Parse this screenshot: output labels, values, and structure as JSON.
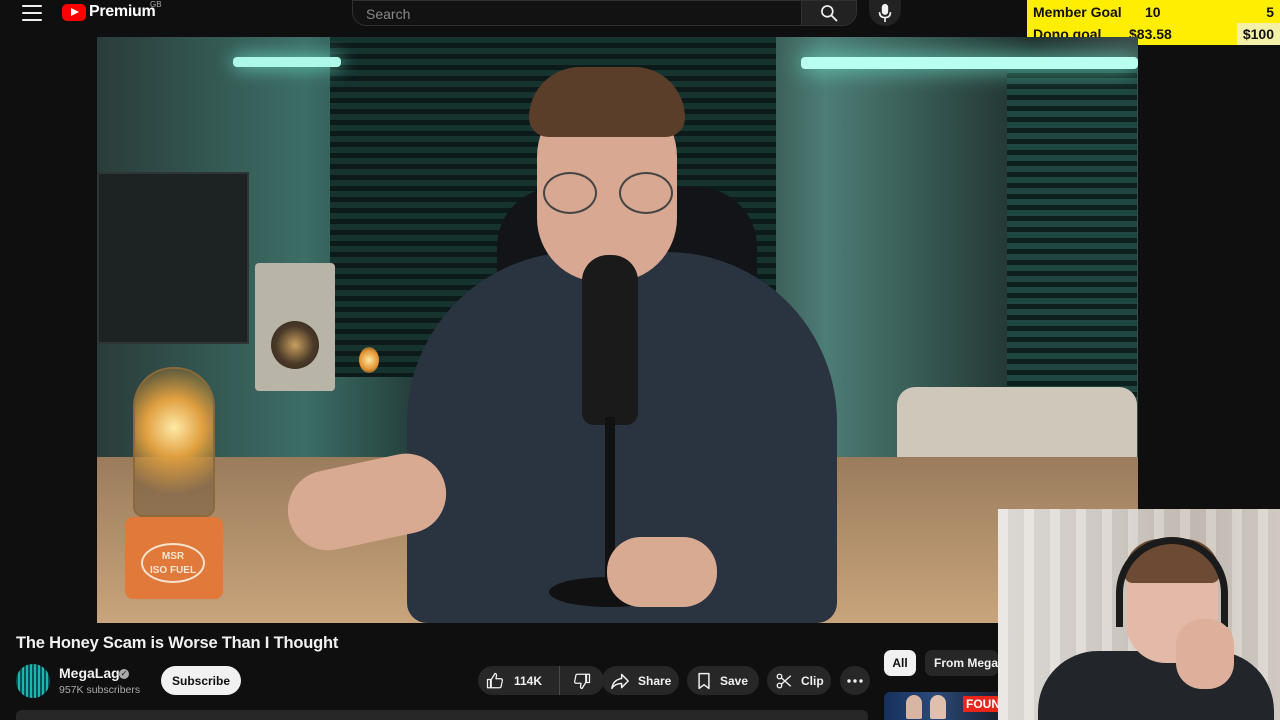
{
  "header": {
    "logo_text": "Premium",
    "region": "GB",
    "search_placeholder": "Search",
    "icons": [
      "menu-icon",
      "search-icon",
      "mic-icon"
    ]
  },
  "overlay": {
    "member_goal_label": "Member Goal",
    "member_goal_current": "10",
    "member_goal_target": "5",
    "dono_goal_label": "Dono goal",
    "dono_goal_current": "$83.58",
    "dono_goal_target": "$100",
    "background_color": "#ffee00"
  },
  "video": {
    "canister_text": "MSR\nISO FUEL"
  },
  "watch": {
    "title": "The Honey Scam is Worse Than I Thought",
    "channel_name": "MegaLag",
    "subscribers": "957K subscribers",
    "subscribe_label": "Subscribe",
    "like_count": "114K",
    "share_label": "Share",
    "save_label": "Save",
    "clip_label": "Clip"
  },
  "related": {
    "chips": [
      "All",
      "From MegaL"
    ],
    "thumbnail_label": "FOUN"
  },
  "colors": {
    "background": "#0f0f0f",
    "brand_red": "#ff0000",
    "pill": "#272727"
  }
}
